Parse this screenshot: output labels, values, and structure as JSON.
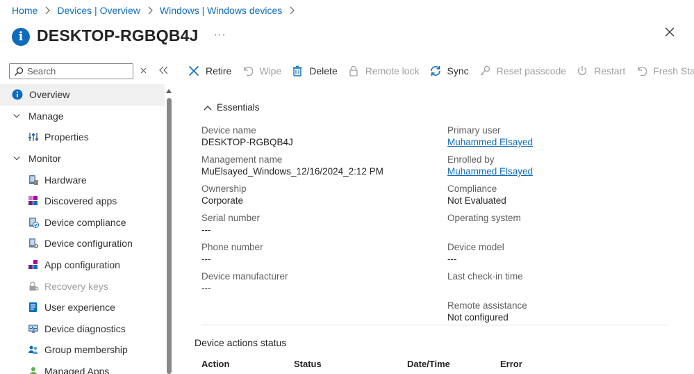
{
  "breadcrumb": [
    "Home",
    "Devices | Overview",
    "Windows | Windows devices"
  ],
  "page": {
    "title": "DESKTOP-RGBQB4J",
    "more": "···"
  },
  "sidebar": {
    "search_placeholder": "Search",
    "items": [
      {
        "label": "Overview"
      },
      {
        "label": "Manage"
      },
      {
        "label": "Properties"
      },
      {
        "label": "Monitor"
      },
      {
        "label": "Hardware"
      },
      {
        "label": "Discovered apps"
      },
      {
        "label": "Device compliance"
      },
      {
        "label": "Device configuration"
      },
      {
        "label": "App configuration"
      },
      {
        "label": "Recovery keys"
      },
      {
        "label": "User experience"
      },
      {
        "label": "Device diagnostics"
      },
      {
        "label": "Group membership"
      },
      {
        "label": "Managed Apps"
      }
    ]
  },
  "toolbar": {
    "retire": "Retire",
    "wipe": "Wipe",
    "delete": "Delete",
    "remote_lock": "Remote lock",
    "sync": "Sync",
    "reset_passcode": "Reset passcode",
    "restart": "Restart",
    "fresh_start": "Fresh Start",
    "more": "···"
  },
  "essentials": {
    "title": "Essentials",
    "left": [
      {
        "label": "Device name",
        "value": "DESKTOP-RGBQB4J"
      },
      {
        "label": "Management name",
        "value": "MuElsayed_Windows_12/16/2024_2:12 PM"
      },
      {
        "label": "Ownership",
        "value": "Corporate"
      },
      {
        "label": "Serial number",
        "value": "---"
      },
      {
        "label": "Phone number",
        "value": "---"
      },
      {
        "label": "Device manufacturer",
        "value": "---"
      }
    ],
    "right": [
      {
        "label": "Primary user",
        "value": "Muhammed Elsayed"
      },
      {
        "label": "Enrolled by",
        "value": "Muhammed Elsayed"
      },
      {
        "label": "Compliance",
        "value": "Not Evaluated"
      },
      {
        "label": "Operating system",
        "value": ""
      },
      {
        "label": "Device model",
        "value": "---"
      },
      {
        "label": "Last check-in time",
        "value": ""
      },
      {
        "label": "Remote assistance",
        "value": "Not configured"
      }
    ]
  },
  "actions_status": {
    "title": "Device actions status",
    "columns": [
      "Action",
      "Status",
      "Date/Time",
      "Error"
    ]
  },
  "colors": {
    "accent": "#0f6cbd",
    "selected_bg": "#f0f0f0",
    "disabled": "#a19f9d"
  }
}
